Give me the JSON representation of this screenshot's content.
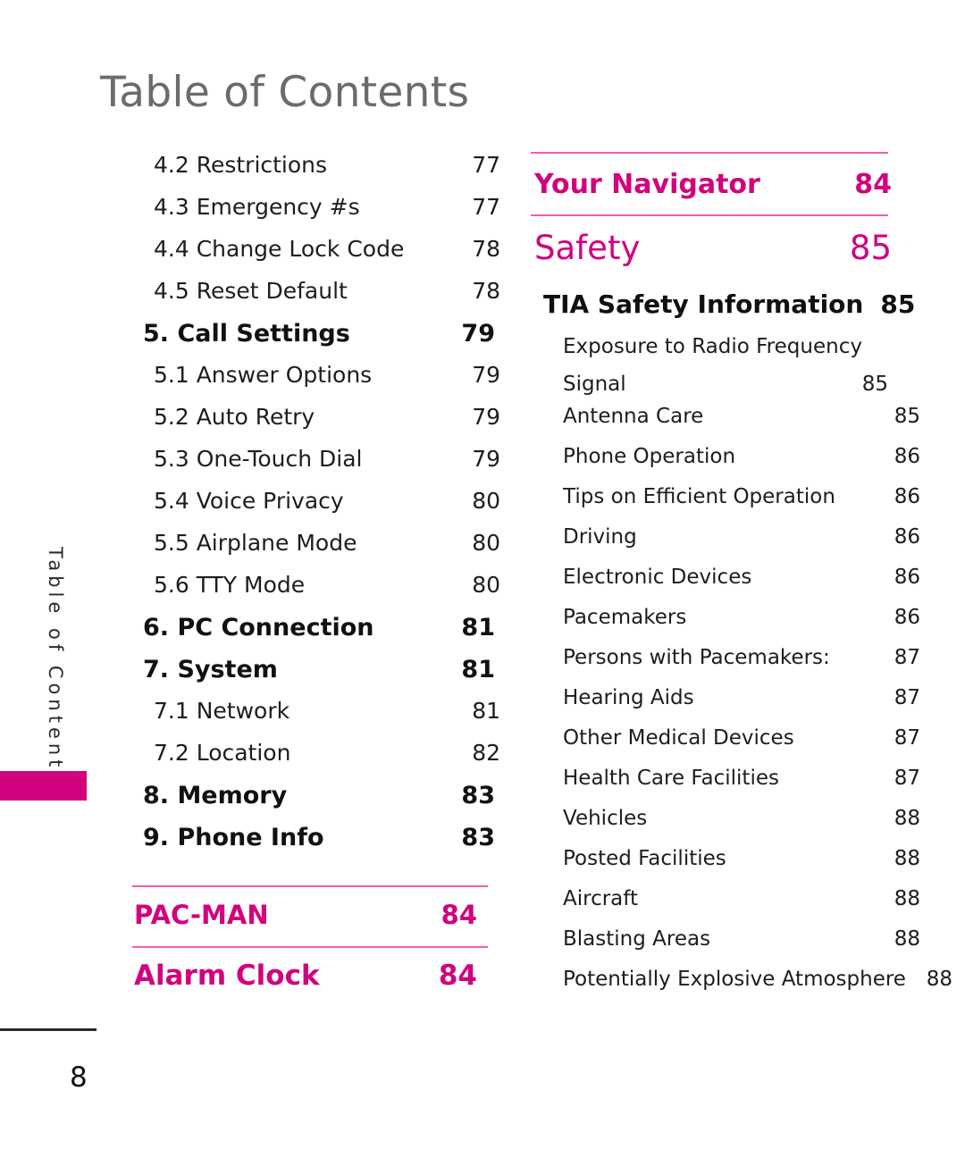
{
  "page": {
    "title": "Table of Contents",
    "side_tab_label": "Table of Contents",
    "footer_page_number": "8",
    "accent_color": "#d2017e",
    "rule_color": "#ef5fa8",
    "title_color": "#6b6b6b"
  },
  "left_column": {
    "entries": [
      {
        "level": 2,
        "label": "4.2 Restrictions",
        "page": "77"
      },
      {
        "level": 2,
        "label": "4.3 Emergency #s",
        "page": "77"
      },
      {
        "level": 2,
        "label": "4.4 Change Lock Code",
        "page": "78"
      },
      {
        "level": 2,
        "label": "4.5 Reset Default",
        "page": "78"
      },
      {
        "level": 1,
        "label": "5. Call Settings",
        "page": "79"
      },
      {
        "level": 2,
        "label": "5.1 Answer Options",
        "page": "79"
      },
      {
        "level": 2,
        "label": "5.2 Auto Retry",
        "page": "79"
      },
      {
        "level": 2,
        "label": "5.3 One-Touch Dial",
        "page": "79"
      },
      {
        "level": 2,
        "label": "5.4 Voice Privacy",
        "page": "80"
      },
      {
        "level": 2,
        "label": "5.5 Airplane Mode",
        "page": "80"
      },
      {
        "level": 2,
        "label": "5.6 TTY Mode",
        "page": "80"
      },
      {
        "level": 1,
        "label": "6. PC Connection",
        "page": "81"
      },
      {
        "level": 1,
        "label": "7. System",
        "page": "81"
      },
      {
        "level": 2,
        "label": "7.1 Network",
        "page": "81"
      },
      {
        "level": 2,
        "label": "7.2 Location",
        "page": "82"
      },
      {
        "level": 1,
        "label": "8. Memory",
        "page": "83"
      },
      {
        "level": 1,
        "label": "9. Phone Info",
        "page": "83"
      }
    ],
    "pacman": {
      "label": "PAC-MAN",
      "page": "84"
    },
    "alarm_clock": {
      "label": "Alarm Clock",
      "page": "84"
    }
  },
  "right_column": {
    "navigator": {
      "label": "Your Navigator",
      "page": "84"
    },
    "safety": {
      "label": "Safety",
      "page": "85"
    },
    "tia": {
      "label": "TIA Safety Information",
      "page": "85"
    },
    "entries": [
      {
        "label": "Exposure to Radio Frequency",
        "label2": "Signal",
        "page": "85",
        "wrapped": true
      },
      {
        "label": "Antenna Care",
        "page": "85"
      },
      {
        "label": "Phone Operation",
        "page": "86"
      },
      {
        "label": "Tips on Efficient Operation",
        "page": "86"
      },
      {
        "label": "Driving",
        "page": "86"
      },
      {
        "label": "Electronic Devices",
        "page": "86"
      },
      {
        "label": "Pacemakers",
        "page": "86"
      },
      {
        "label": "Persons with Pacemakers:",
        "page": "87"
      },
      {
        "label": "Hearing Aids",
        "page": "87"
      },
      {
        "label": "Other Medical Devices",
        "page": "87"
      },
      {
        "label": "Health Care Facilities",
        "page": "87"
      },
      {
        "label": "Vehicles",
        "page": "88"
      },
      {
        "label": "Posted Facilities",
        "page": "88"
      },
      {
        "label": "Aircraft",
        "page": "88"
      },
      {
        "label": "Blasting Areas",
        "page": "88"
      },
      {
        "label": "Potentially Explosive Atmosphere",
        "page": "88"
      }
    ]
  }
}
